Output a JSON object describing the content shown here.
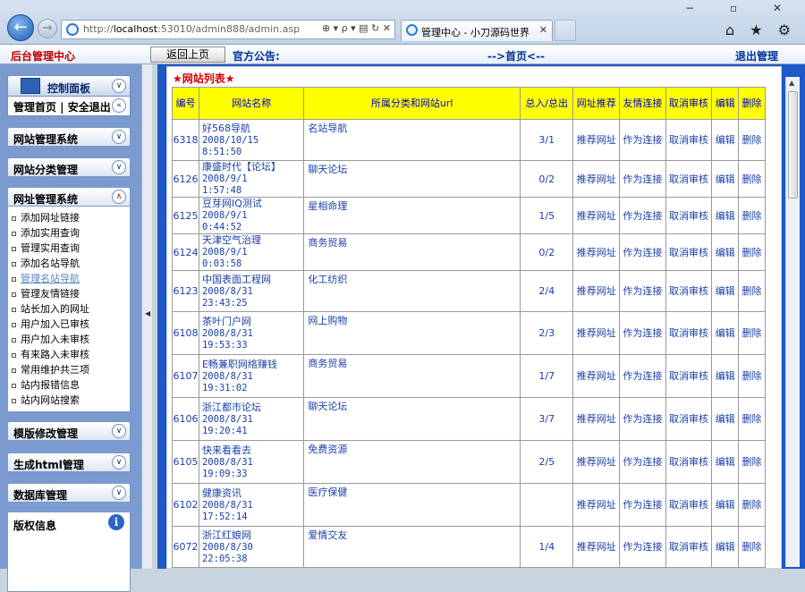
{
  "browser": {
    "url_prefix": "http://",
    "url_host": "localhost",
    "url_rest": ":53010/admin888/admin.asp",
    "tab_title": "管理中心 - 小刀源码世界",
    "tab_close": "✕",
    "addr_tools": "⊕ ▾  ρ ▾  ▤ ↻ ✕",
    "window_controls": "− ▫ ✕",
    "toolbar_icons": "⌂ ★ ⚙"
  },
  "topbar": {
    "admin_center": "后台管理中心",
    "back_button": "返回上页",
    "notice": "官方公告:",
    "home_link": "-->首页<--",
    "logout": "退出管理"
  },
  "sidebar": {
    "control_panel": "控制面板",
    "quick_links": "管理首页 | 安全退出",
    "groups": {
      "site_mgmt": "网站管理系统",
      "site_category": "网站分类管理",
      "url_mgmt": "网址管理系统",
      "template": "模版修改管理",
      "html_gen": "生成html管理",
      "database": "数据库管理"
    },
    "url_items": [
      "添加网址链接",
      "添加实用查询",
      "管理实用查询",
      "添加名站导航",
      "管理名站导航",
      "管理友情链接",
      "站长加入的网址",
      "用户加入已审核",
      "用户加入未审核",
      "有来路入未审核",
      "常用维护共三项",
      "站内报错信息",
      "站内网站搜索"
    ],
    "copyright": "版权信息",
    "info_icon_glyph": "i"
  },
  "main": {
    "panel_title": "★网站列表★",
    "columns": [
      "编号",
      "网站名称",
      "所属分类和网站url",
      "总入/总出",
      "网址推荐",
      "友情连接",
      "取消审核",
      "编辑",
      "删除"
    ],
    "action_labels": {
      "recommend": "推荐网址",
      "friend_link": "作为连接",
      "cancel_review": "取消审核",
      "edit": "编辑",
      "delete": "删除"
    },
    "rows": [
      {
        "id": "6318",
        "name": "好568导航",
        "date": "2008/10/15",
        "time": "8:51:50",
        "category": "名站导航",
        "ratio": "3/1"
      },
      {
        "id": "6126",
        "name": "康盛时代【论坛】",
        "date": "2008/9/1",
        "time": "1:57:48",
        "category": "聊天论坛",
        "ratio": "0/2"
      },
      {
        "id": "6125",
        "name": "豆芽网IQ测试",
        "date": "2008/9/1",
        "time": "0:44:52",
        "category": "星相命理",
        "ratio": "1/5"
      },
      {
        "id": "6124",
        "name": "天津空气治理",
        "date": "2008/9/1",
        "time": "0:03:58",
        "category": "商务贸易",
        "ratio": "0/2"
      },
      {
        "id": "6123",
        "name": "中国表面工程网",
        "date": "2008/8/31",
        "time": "23:43:25",
        "category": "化工纺织",
        "ratio": "2/4"
      },
      {
        "id": "6108",
        "name": "茶叶门户网",
        "date": "2008/8/31",
        "time": "19:53:33",
        "category": "网上购物",
        "ratio": "2/3"
      },
      {
        "id": "6107",
        "name": "E畅兼职网络赚钱",
        "date": "2008/8/31",
        "time": "19:31:02",
        "category": "商务贸易",
        "ratio": "1/7"
      },
      {
        "id": "6106",
        "name": "浙江都市论坛",
        "date": "2008/8/31",
        "time": "19:20:41",
        "category": "聊天论坛",
        "ratio": "3/7"
      },
      {
        "id": "6105",
        "name": "快来看看去",
        "date": "2008/8/31",
        "time": "19:09:33",
        "category": "免费资源",
        "ratio": "2/5"
      },
      {
        "id": "6102",
        "name": "健康资讯",
        "date": "2008/8/31",
        "time": "17:52:14",
        "category": "医疗保健",
        "ratio": ""
      },
      {
        "id": "6072",
        "name": "浙江红娘网",
        "date": "2008/8/30",
        "time": "22:05:38",
        "category": "爱情交友",
        "ratio": "1/4"
      }
    ]
  }
}
